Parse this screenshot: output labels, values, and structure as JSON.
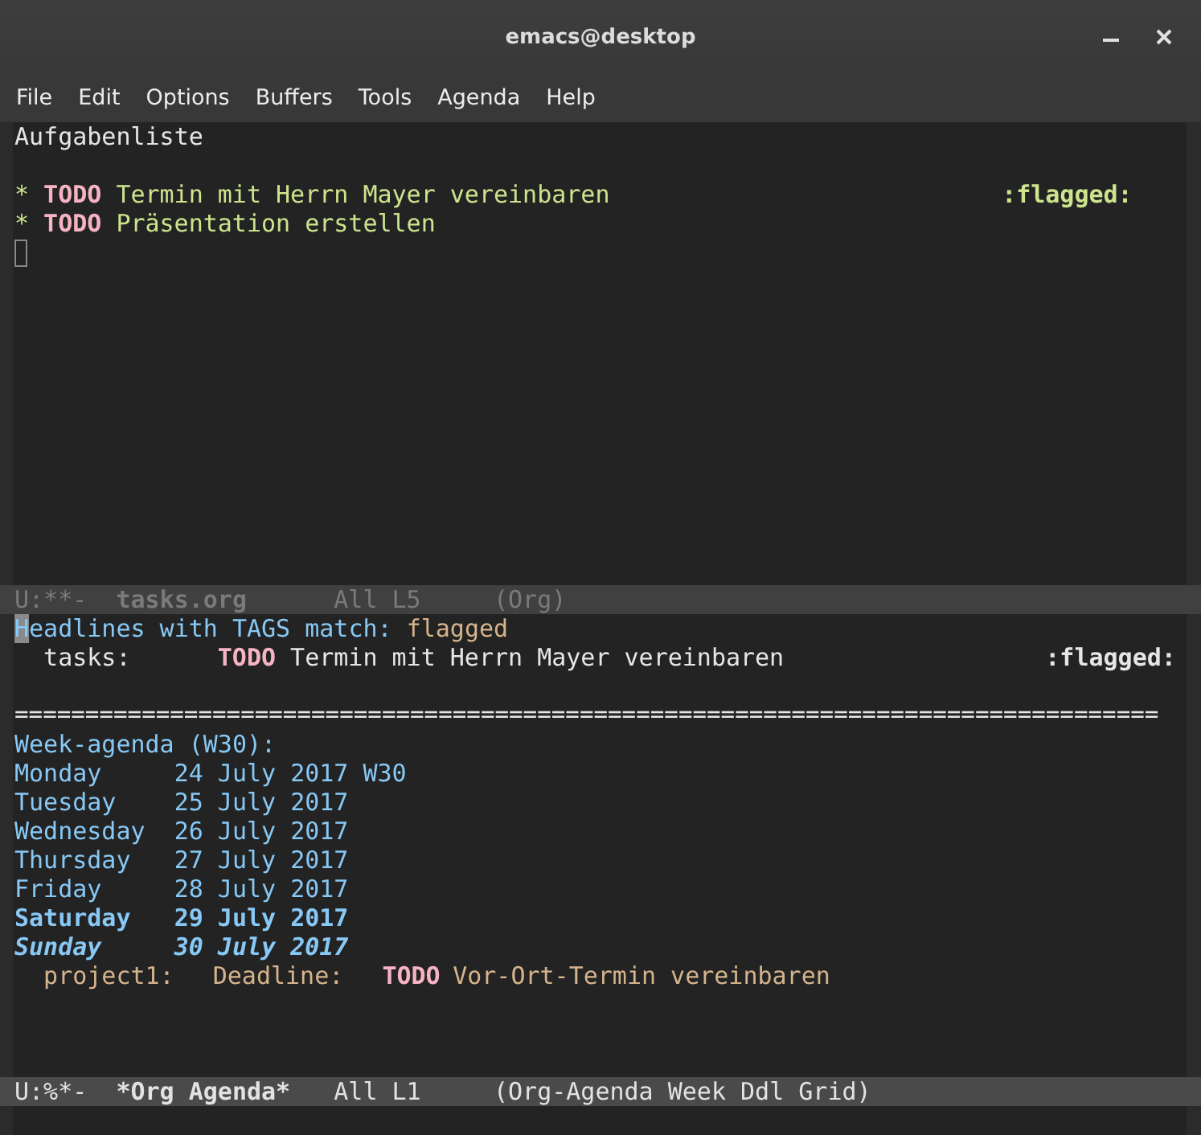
{
  "window": {
    "title": "emacs@desktop"
  },
  "menu": [
    {
      "label": "File"
    },
    {
      "label": "Edit"
    },
    {
      "label": "Options"
    },
    {
      "label": "Buffers"
    },
    {
      "label": "Tools"
    },
    {
      "label": "Agenda"
    },
    {
      "label": "Help"
    }
  ],
  "top_buffer": {
    "title": "Aufgabenliste",
    "headings": [
      {
        "bullet": "*",
        "keyword": "TODO",
        "text": "Termin mit Herrn Mayer vereinbaren",
        "tags": ":flagged:"
      },
      {
        "bullet": "*",
        "keyword": "TODO",
        "text": "Präsentation erstellen"
      }
    ]
  },
  "top_mode_line": {
    "active": false,
    "status": "U:**-",
    "buffer": "tasks.org",
    "position": "All L5",
    "mode": "(Org)"
  },
  "bottom_buffer": {
    "header": {
      "label": "Headlines with TAGS match:",
      "value": "flagged"
    },
    "matches": [
      {
        "category": "tasks:",
        "keyword": "TODO",
        "text": "Termin mit Herrn Mayer vereinbaren",
        "tags": ":flagged:"
      }
    ],
    "separator": "=================================================================================",
    "agenda_title": "Week-agenda (W30):",
    "days": [
      {
        "kind": "weekday",
        "day": "Monday",
        "date": "24 July 2017",
        "week": "W30"
      },
      {
        "kind": "weekday",
        "day": "Tuesday",
        "date": "25 July 2017"
      },
      {
        "kind": "weekday",
        "day": "Wednesday",
        "date": "26 July 2017"
      },
      {
        "kind": "weekday",
        "day": "Thursday",
        "date": "27 July 2017"
      },
      {
        "kind": "weekday",
        "day": "Friday",
        "date": "28 July 2017"
      },
      {
        "kind": "weekend",
        "day": "Saturday",
        "date": "29 July 2017"
      },
      {
        "kind": "today",
        "day": "Sunday",
        "date": "30 July 2017"
      }
    ],
    "entries": [
      {
        "category": "project1:",
        "type": "Deadline:",
        "keyword": "TODO",
        "text": "Vor-Ort-Termin vereinbaren"
      }
    ]
  },
  "bottom_mode_line": {
    "active": true,
    "status": "U:%*-",
    "buffer": "*Org Agenda*",
    "position": "All L1",
    "mode": "(Org-Agenda Week Ddl Grid)"
  }
}
